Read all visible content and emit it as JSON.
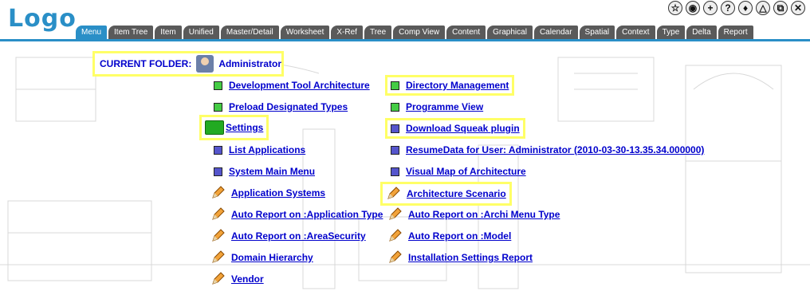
{
  "logo": "Logo",
  "top_icons": [
    {
      "name": "bookmark-icon",
      "glyph": "☆"
    },
    {
      "name": "globe-icon",
      "glyph": "◉"
    },
    {
      "name": "add-icon",
      "glyph": "+"
    },
    {
      "name": "help-icon",
      "glyph": "?"
    },
    {
      "name": "location-icon",
      "glyph": "♦"
    },
    {
      "name": "triangle-icon",
      "glyph": "△"
    },
    {
      "name": "copy-icon",
      "glyph": "⧉"
    },
    {
      "name": "close-icon",
      "glyph": "✕"
    }
  ],
  "tabs": [
    "Menu",
    "Item Tree",
    "Item",
    "Unified",
    "Master/Detail",
    "Worksheet",
    "X-Ref",
    "Tree",
    "Comp View",
    "Content",
    "Graphical",
    "Calendar",
    "Spatial",
    "Context",
    "Type",
    "Delta",
    "Report"
  ],
  "current_folder": {
    "label": "CURRENT FOLDER:",
    "user": "Administrator"
  },
  "left_items": [
    "Development Tool Architecture",
    "Preload Designated Types",
    "Settings",
    "List Applications",
    "System Main Menu",
    "Application Systems",
    "Auto Report on :Application Type",
    "Auto Report on :AreaSecurity",
    "Domain Hierarchy",
    "Vendor"
  ],
  "right_items": [
    "Directory Management",
    "Programme View",
    "Download Squeak plugin",
    "ResumeData for User: Administrator (2010-03-30-13.35.34.000000)",
    "Visual Map of Architecture",
    "Architecture Scenario",
    "Auto Report on :Archi Menu Type",
    "Auto Report on :Model",
    "Installation Settings Report"
  ]
}
